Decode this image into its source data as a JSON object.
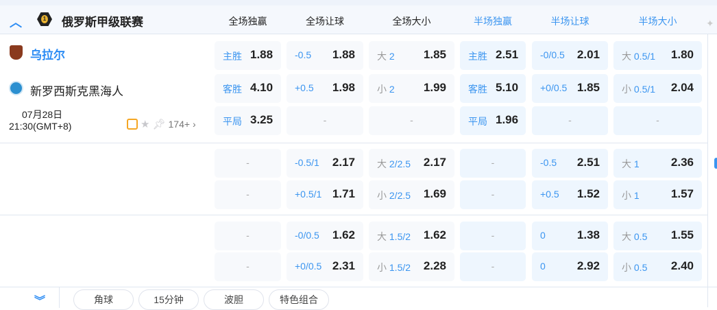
{
  "league": {
    "name": "俄罗斯甲级联赛",
    "icon": "league-badge-icon"
  },
  "columns": [
    {
      "label": "全场独赢",
      "type": "full"
    },
    {
      "label": "全场让球",
      "type": "full"
    },
    {
      "label": "全场大小",
      "type": "full"
    },
    {
      "label": "半场独赢",
      "type": "half"
    },
    {
      "label": "半场让球",
      "type": "half"
    },
    {
      "label": "半场大小",
      "type": "half"
    }
  ],
  "match": {
    "home": "乌拉尔",
    "away": "新罗西斯克黑海人",
    "date": "07月28日",
    "time": "21:30(GMT+8)",
    "more": "174+"
  },
  "blocks": [
    [
      [
        {
          "pre": "",
          "lab": "主胜",
          "val": "1.88"
        },
        {
          "pre": "",
          "lab": "-0.5",
          "val": "1.88"
        },
        {
          "pre": "大",
          "lab": "2",
          "val": "1.85"
        },
        {
          "pre": "",
          "lab": "主胜",
          "val": "2.51"
        },
        {
          "pre": "",
          "lab": "-0/0.5",
          "val": "2.01"
        },
        {
          "pre": "大",
          "lab": "0.5/1",
          "val": "1.80"
        }
      ],
      [
        {
          "pre": "",
          "lab": "客胜",
          "val": "4.10"
        },
        {
          "pre": "",
          "lab": "+0.5",
          "val": "1.98"
        },
        {
          "pre": "小",
          "lab": "2",
          "val": "1.99"
        },
        {
          "pre": "",
          "lab": "客胜",
          "val": "5.10"
        },
        {
          "pre": "",
          "lab": "+0/0.5",
          "val": "1.85"
        },
        {
          "pre": "小",
          "lab": "0.5/1",
          "val": "2.04"
        }
      ],
      [
        {
          "pre": "",
          "lab": "平局",
          "val": "3.25"
        },
        null,
        null,
        {
          "pre": "",
          "lab": "平局",
          "val": "1.96"
        },
        null,
        null
      ]
    ],
    [
      [
        null,
        {
          "pre": "",
          "lab": "-0.5/1",
          "val": "2.17"
        },
        {
          "pre": "大",
          "lab": "2/2.5",
          "val": "2.17"
        },
        null,
        {
          "pre": "",
          "lab": "-0.5",
          "val": "2.51"
        },
        {
          "pre": "大",
          "lab": "1",
          "val": "2.36"
        }
      ],
      [
        null,
        {
          "pre": "",
          "lab": "+0.5/1",
          "val": "1.71"
        },
        {
          "pre": "小",
          "lab": "2/2.5",
          "val": "1.69"
        },
        null,
        {
          "pre": "",
          "lab": "+0.5",
          "val": "1.52"
        },
        {
          "pre": "小",
          "lab": "1",
          "val": "1.57"
        }
      ]
    ],
    [
      [
        null,
        {
          "pre": "",
          "lab": "-0/0.5",
          "val": "1.62"
        },
        {
          "pre": "大",
          "lab": "1.5/2",
          "val": "1.62"
        },
        null,
        {
          "pre": "",
          "lab": "0",
          "val": "1.38"
        },
        {
          "pre": "大",
          "lab": "0.5",
          "val": "1.55"
        }
      ],
      [
        null,
        {
          "pre": "",
          "lab": "+0/0.5",
          "val": "2.31"
        },
        {
          "pre": "小",
          "lab": "1.5/2",
          "val": "2.28"
        },
        null,
        {
          "pre": "",
          "lab": "0",
          "val": "2.92"
        },
        {
          "pre": "小",
          "lab": "0.5",
          "val": "2.40"
        }
      ]
    ]
  ],
  "empty": "-",
  "bottom_tabs": [
    "角球",
    "15分钟",
    "波胆",
    "特色组合"
  ]
}
